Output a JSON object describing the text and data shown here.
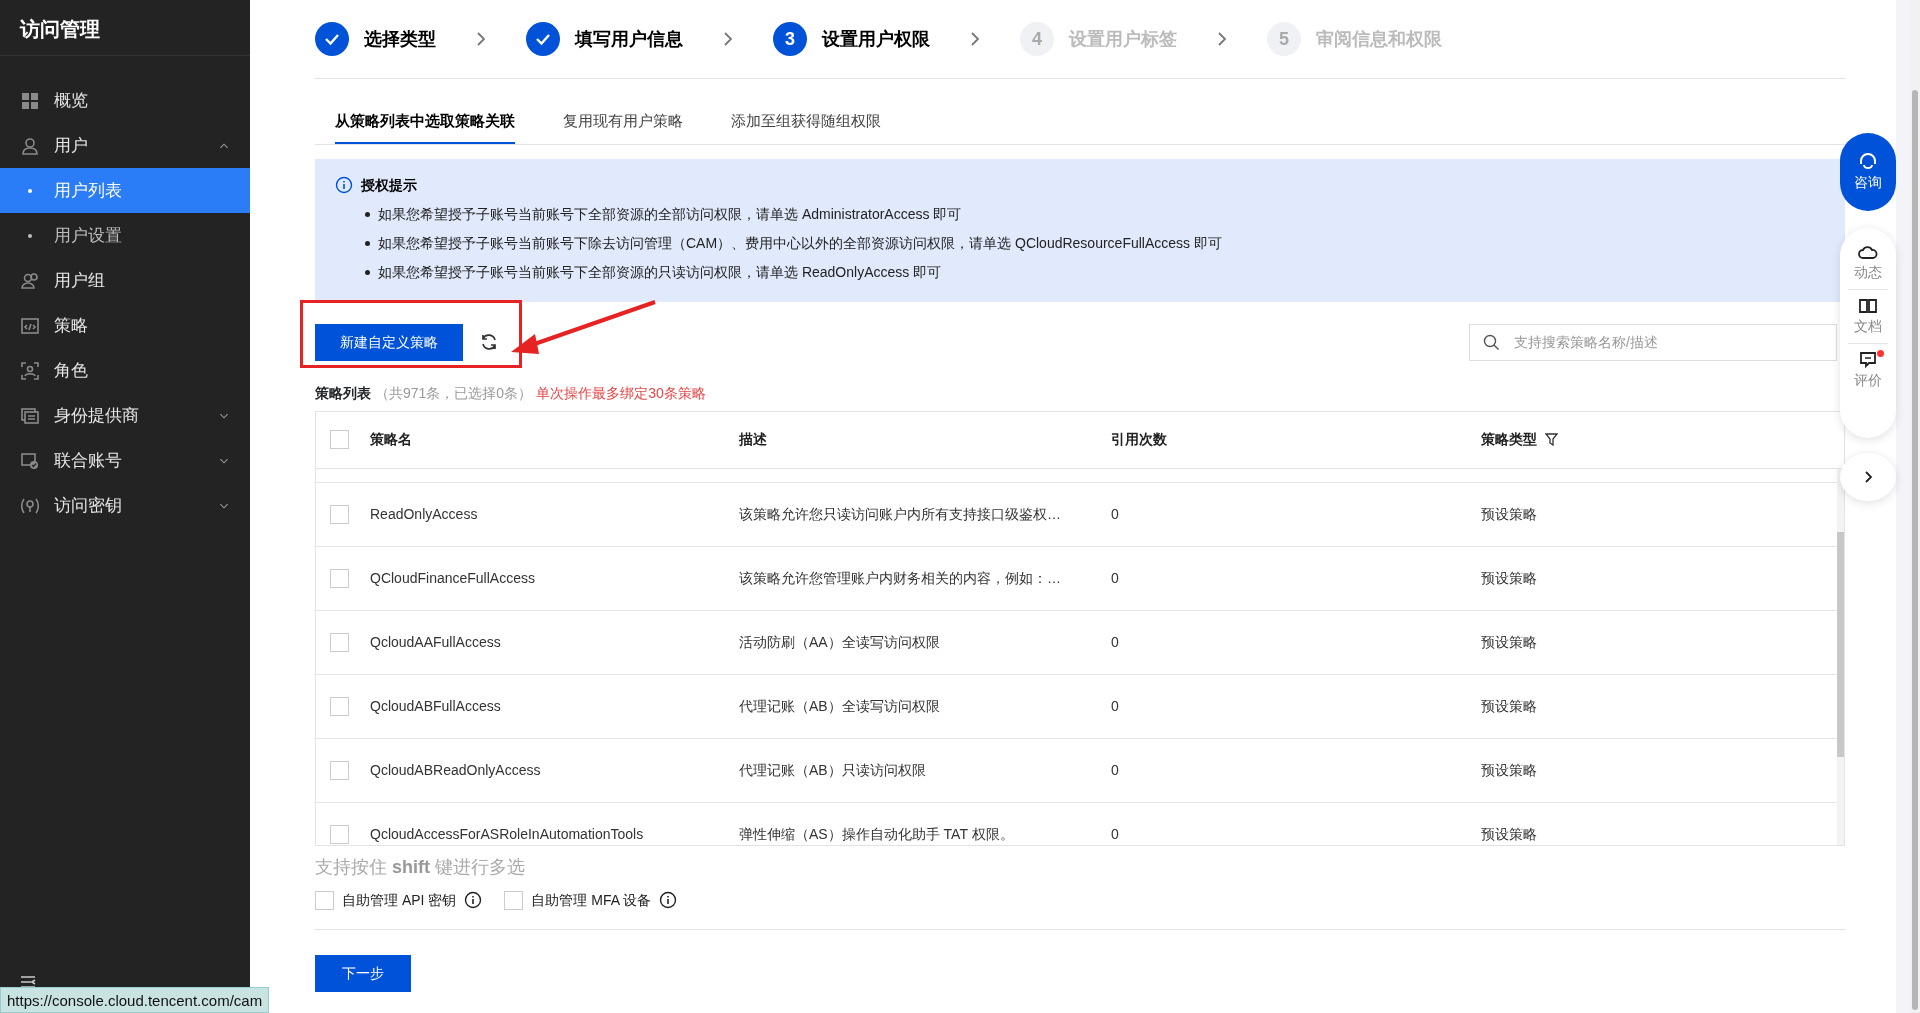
{
  "sidebar": {
    "title": "访问管理",
    "items": [
      {
        "label": "概览",
        "selected": false
      },
      {
        "label": "用户",
        "selected": false,
        "expanded": true,
        "children": [
          {
            "label": "用户列表",
            "selected": true
          },
          {
            "label": "用户设置",
            "selected": false
          }
        ]
      },
      {
        "label": "用户组",
        "selected": false
      },
      {
        "label": "策略",
        "selected": false
      },
      {
        "label": "角色",
        "selected": false
      },
      {
        "label": "身份提供商",
        "selected": false,
        "expanded": false
      },
      {
        "label": "联合账号",
        "selected": false,
        "expanded": false
      },
      {
        "label": "访问密钥",
        "selected": false,
        "expanded": false
      }
    ]
  },
  "steps": [
    {
      "label": "选择类型",
      "done": true,
      "active": true
    },
    {
      "label": "填写用户信息",
      "done": true,
      "active": true
    },
    {
      "number": "3",
      "label": "设置用户权限",
      "done": false,
      "active": true
    },
    {
      "number": "4",
      "label": "设置用户标签",
      "done": false,
      "active": false
    },
    {
      "number": "5",
      "label": "审阅信息和权限",
      "done": false,
      "active": false
    }
  ],
  "tabs": [
    {
      "label": "从策略列表中选取策略关联",
      "selected": true
    },
    {
      "label": "复用现有用户策略",
      "selected": false
    },
    {
      "label": "添加至组获得随组权限",
      "selected": false
    }
  ],
  "notice": {
    "title": "授权提示",
    "items": [
      "如果您希望授予子账号当前账号下全部资源的全部访问权限，请单选 AdministratorAccess 即可",
      "如果您希望授予子账号当前账号下除去访问管理（CAM）、费用中心以外的全部资源访问权限，请单选 QCloudResourceFullAccess 即可",
      "如果您希望授予子账号当前账号下全部资源的只读访问权限，请单选 ReadOnlyAccess 即可"
    ]
  },
  "toolbar": {
    "create_button": "新建自定义策略",
    "search": {
      "placeholder": "支持搜索策略名称/描述"
    }
  },
  "table": {
    "title": "策略列表",
    "count": "（共971条，已选择0条）",
    "warning": "单次操作最多绑定30条策略",
    "all_checked": false,
    "columns": [
      "策略名",
      "描述",
      "引用次数",
      "策略类型"
    ],
    "rows": [
      {
        "checked": false,
        "cells": [
          "ReadOnlyAccess",
          "该策略允许您只读访问账户内所有支持接口级鉴权…",
          "0",
          "预设策略"
        ]
      },
      {
        "checked": false,
        "cells": [
          "QCloudFinanceFullAccess",
          "该策略允许您管理账户内财务相关的内容，例如：…",
          "0",
          "预设策略"
        ]
      },
      {
        "checked": false,
        "cells": [
          "QcloudAAFullAccess",
          "活动防刷（AA）全读写访问权限",
          "0",
          "预设策略"
        ]
      },
      {
        "checked": false,
        "cells": [
          "QcloudABFullAccess",
          "代理记账（AB）全读写访问权限",
          "0",
          "预设策略"
        ]
      },
      {
        "checked": false,
        "cells": [
          "QcloudABReadOnlyAccess",
          "代理记账（AB）只读访问权限",
          "0",
          "预设策略"
        ]
      },
      {
        "checked": false,
        "cells": [
          "QcloudAccessForASRoleInAutomationTools",
          "弹性伸缩（AS）操作自动化助手 TAT 权限。",
          "0",
          "预设策略"
        ]
      }
    ]
  },
  "hint": "支持按住 **shift** 键进行多选",
  "options": [
    {
      "label": "自助管理 API 密钥",
      "checked": false
    },
    {
      "label": "自助管理 MFA 设备",
      "checked": false
    }
  ],
  "next_button": "下一步",
  "float_panel": {
    "consult": "咨询",
    "items": [
      {
        "label": "动态",
        "notification": false
      },
      {
        "label": "文档",
        "notification": false
      },
      {
        "label": "评价",
        "notification": true
      }
    ]
  },
  "status_bar": {
    "url": "https://console.cloud.tencent.com/cam"
  }
}
